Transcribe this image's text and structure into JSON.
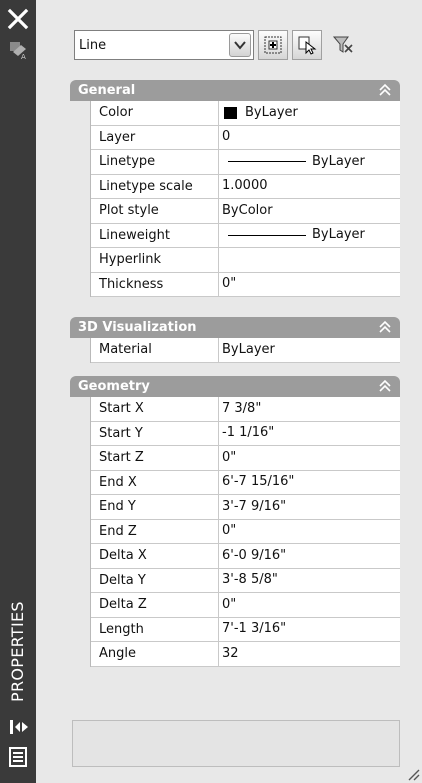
{
  "palette": {
    "title": "PROPERTIES"
  },
  "selector": {
    "value": "Line"
  },
  "sections": [
    {
      "title": "General",
      "rows": [
        {
          "label": "Color",
          "value": "ByLayer",
          "swatch": "#000000"
        },
        {
          "label": "Layer",
          "value": "0"
        },
        {
          "label": "Linetype",
          "value": "ByLayer",
          "line": true
        },
        {
          "label": "Linetype scale",
          "value": "1.0000"
        },
        {
          "label": "Plot style",
          "value": "ByColor"
        },
        {
          "label": "Lineweight",
          "value": "ByLayer",
          "line": true
        },
        {
          "label": "Hyperlink",
          "value": ""
        },
        {
          "label": "Thickness",
          "value": "0\""
        }
      ]
    },
    {
      "title": "3D Visualization",
      "rows": [
        {
          "label": "Material",
          "value": "ByLayer"
        }
      ]
    },
    {
      "title": "Geometry",
      "rows": [
        {
          "label": "Start X",
          "value": "7 3/8\""
        },
        {
          "label": "Start Y",
          "value": "-1 1/16\""
        },
        {
          "label": "Start Z",
          "value": "0\""
        },
        {
          "label": "End X",
          "value": "6'-7 15/16\""
        },
        {
          "label": "End Y",
          "value": "3'-7 9/16\""
        },
        {
          "label": "End Z",
          "value": "0\""
        },
        {
          "label": "Delta X",
          "value": "6'-0 9/16\""
        },
        {
          "label": "Delta Y",
          "value": "3'-8 5/8\""
        },
        {
          "label": "Delta Z",
          "value": "0\""
        },
        {
          "label": "Length",
          "value": "7'-1 3/16\""
        },
        {
          "label": "Angle",
          "value": "32"
        }
      ]
    }
  ],
  "icons": {
    "close": "close-icon",
    "relative": "properties-palette-icon",
    "autohide": "auto-hide-icon",
    "menu": "palette-menu-icon",
    "toggle_pickadd": "toggle-pickadd-icon",
    "select_objects": "select-objects-icon",
    "quick_select": "quick-select-icon"
  }
}
